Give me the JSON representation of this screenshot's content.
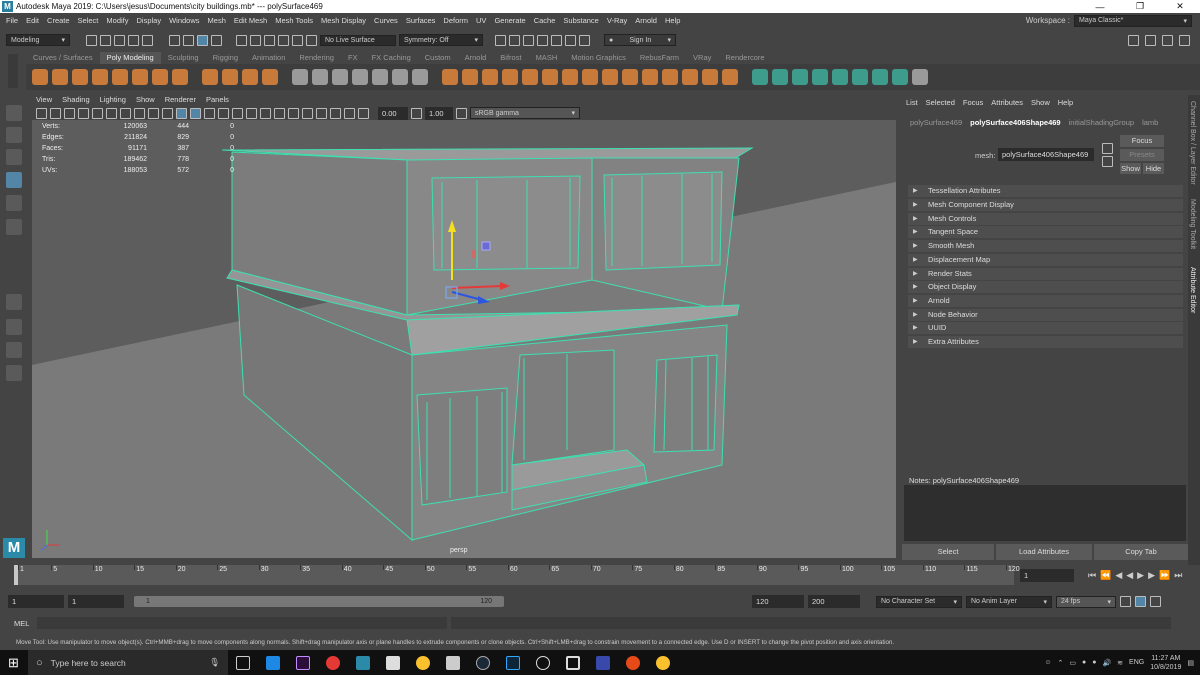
{
  "window": {
    "title": "Autodesk Maya 2019: C:\\Users\\jesus\\Documents\\city buildings.mb*  ---  polySurface469",
    "minimize": "—",
    "maximize": "❐",
    "close": "✕"
  },
  "menubar": {
    "items": [
      "File",
      "Edit",
      "Create",
      "Select",
      "Modify",
      "Display",
      "Windows",
      "Mesh",
      "Edit Mesh",
      "Mesh Tools",
      "Mesh Display",
      "Curves",
      "Surfaces",
      "Deform",
      "UV",
      "Generate",
      "Cache",
      "Substance",
      "V-Ray",
      "Arnold",
      "Help"
    ],
    "workspace_label": "Workspace :",
    "workspace_value": "Maya Classic*"
  },
  "statusline": {
    "mode": "Modeling",
    "live": "No Live Surface",
    "symmetry": "Symmetry: Off",
    "signin": "Sign In"
  },
  "shelf": {
    "tabs": [
      "Curves / Surfaces",
      "Poly Modeling",
      "Sculpting",
      "Rigging",
      "Animation",
      "Rendering",
      "FX",
      "FX Caching",
      "Custom",
      "Arnold",
      "Bifrost",
      "MASH",
      "Motion Graphics",
      "RebusFarm",
      "VRay",
      "Rendercore"
    ],
    "active_tab": "Poly Modeling"
  },
  "viewport": {
    "menu": [
      "View",
      "Shading",
      "Lighting",
      "Show",
      "Renderer",
      "Panels"
    ],
    "field1": "0.00",
    "field2": "1.00",
    "colorspace": "sRGB gamma",
    "camera": "persp",
    "hud": [
      {
        "label": "Verts:",
        "a": "120063",
        "b": "444",
        "c": "0"
      },
      {
        "label": "Edges:",
        "a": "211824",
        "b": "829",
        "c": "0"
      },
      {
        "label": "Faces:",
        "a": "91171",
        "b": "387",
        "c": "0"
      },
      {
        "label": "Tris:",
        "a": "189462",
        "b": "778",
        "c": "0"
      },
      {
        "label": "UVs:",
        "a": "188053",
        "b": "572",
        "c": "0"
      }
    ]
  },
  "attribute_editor": {
    "menu": [
      "List",
      "Selected",
      "Focus",
      "Attributes",
      "Show",
      "Help"
    ],
    "tabs": [
      "polySurface469",
      "polySurface406Shape469",
      "initialShadingGroup",
      "lamb"
    ],
    "active_tab": "polySurface406Shape469",
    "mesh_label": "mesh:",
    "mesh_value": "polySurface406Shape469",
    "focus": "Focus",
    "presets": "Presets",
    "show": "Show",
    "hide": "Hide",
    "sections": [
      "Tessellation Attributes",
      "Mesh Component Display",
      "Mesh Controls",
      "Tangent Space",
      "Smooth Mesh",
      "Displacement Map",
      "Render Stats",
      "Object Display",
      "Arnold",
      "Node Behavior",
      "UUID",
      "Extra Attributes"
    ],
    "notes": "Notes:  polySurface406Shape469",
    "select": "Select",
    "load": "Load Attributes",
    "copy": "Copy Tab"
  },
  "side_tabs": [
    "Channel Box / Layer Editor",
    "Modeling Toolkit",
    "Attribute Editor"
  ],
  "timeline": {
    "ticks": [
      "1",
      "5",
      "10",
      "15",
      "20",
      "25",
      "30",
      "35",
      "40",
      "45",
      "50",
      "55",
      "60",
      "65",
      "70",
      "75",
      "80",
      "85",
      "90",
      "95",
      "100",
      "105",
      "110",
      "115",
      "120"
    ],
    "current": "1"
  },
  "range": {
    "start": "1",
    "start2": "1",
    "slider_start": "1",
    "slider_end": "120",
    "end": "120",
    "end2": "200",
    "char_set": "No Character Set",
    "anim_layer": "No Anim Layer",
    "fps": "24 fps"
  },
  "mel": {
    "label": "MEL"
  },
  "help": "Move Tool: Use manipulator to move object(s). Ctrl+MMB+drag to move components along normals. Shift+drag manipulator axis or plane handles to extrude components or clone objects. Ctrl+Shift+LMB+drag to constrain movement to a connected edge. Use D or INSERT to change the pivot position and axis orientation.",
  "taskbar": {
    "search": "Type here to search",
    "lang": "ENG",
    "time": "11:27 AM",
    "date": "10/8/2019"
  },
  "colors": {
    "wire": "#3de0b0",
    "accent": "#5285a6"
  }
}
